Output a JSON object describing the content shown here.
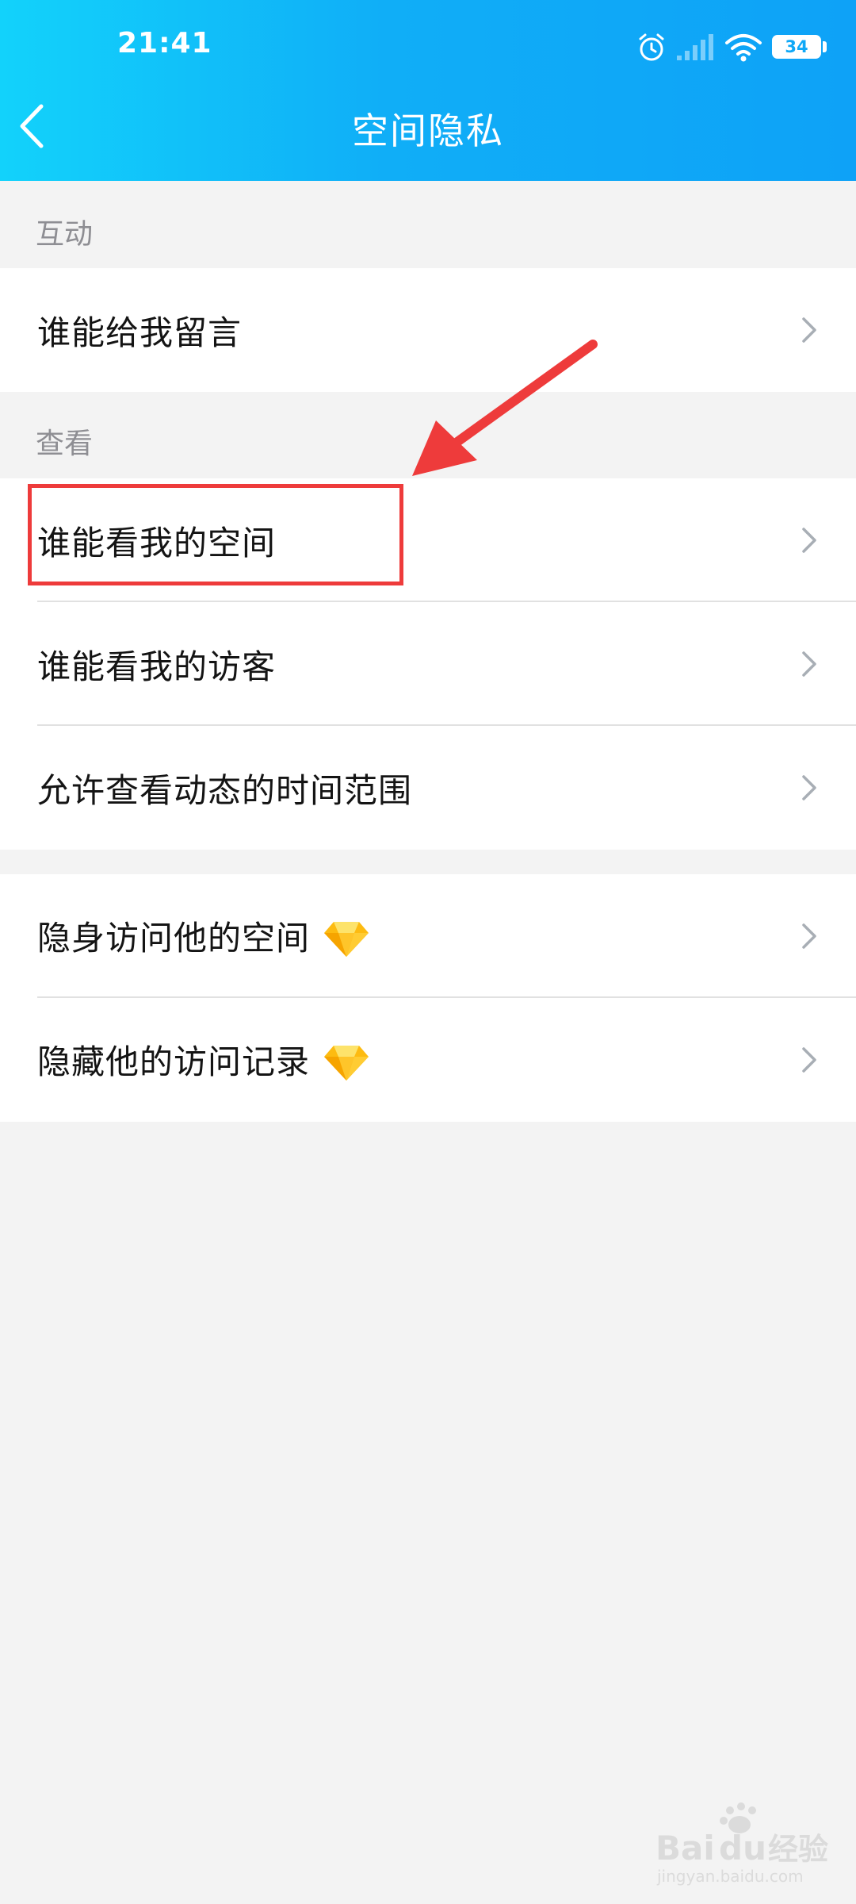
{
  "status": {
    "time": "21:41",
    "battery_level": "34",
    "icons": [
      "alarm-icon",
      "signal-icon",
      "wifi-icon",
      "battery-icon"
    ]
  },
  "header": {
    "title": "空间隐私",
    "back_icon": "chevron-left-icon"
  },
  "sections": [
    {
      "label": "互动",
      "items": [
        {
          "label": "谁能给我留言"
        }
      ]
    },
    {
      "label": "查看",
      "items": [
        {
          "label": "谁能看我的空间",
          "highlighted": true
        },
        {
          "label": "谁能看我的访客"
        },
        {
          "label": "允许查看动态的时间范围"
        }
      ]
    },
    {
      "label": "",
      "items": [
        {
          "label": "隐身访问他的空间",
          "badge_icon": "diamond-icon"
        },
        {
          "label": "隐藏他的访问记录",
          "badge_icon": "diamond-icon"
        }
      ]
    }
  ],
  "annotation": {
    "color": "#ee3b3b"
  },
  "watermark": {
    "brand": "Bai du 经验",
    "url": "jingyan.baidu.com"
  },
  "colors": {
    "header_gradient_start": "#12d2fb",
    "header_gradient_end": "#0ea2f7",
    "background": "#f3f3f3",
    "row_background": "#ffffff",
    "section_label": "#8e8e93",
    "chevron": "#a8aeb5",
    "gem": "#fdbb11"
  }
}
